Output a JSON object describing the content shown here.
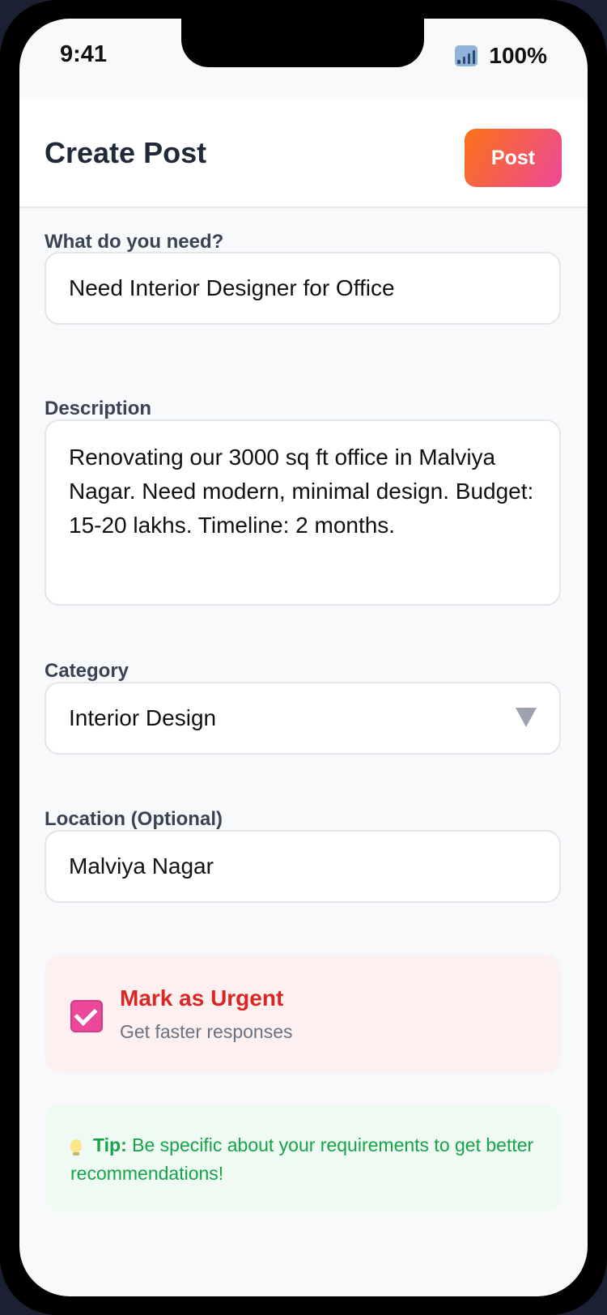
{
  "status_bar": {
    "time": "9:41",
    "battery": "100%",
    "signal_icon": "signal-icon"
  },
  "header": {
    "title": "Create Post",
    "post_label": "Post"
  },
  "form": {
    "need": {
      "label": "What do you need?",
      "value": "Need Interior Designer for Office"
    },
    "description": {
      "label": "Description",
      "value": "Renovating our 3000 sq ft office in Malviya Nagar. Need modern, minimal design. Budget: 15-20 lakhs. Timeline: 2 months."
    },
    "category": {
      "label": "Category",
      "value": "Interior Design"
    },
    "location": {
      "label": "Location (Optional)",
      "value": "Malviya Nagar"
    }
  },
  "urgent": {
    "checked": true,
    "title": "Mark as Urgent",
    "subtitle": "Get faster responses"
  },
  "tip": {
    "icon": "lightbulb-icon",
    "label": "Tip:",
    "text": "Be specific about your requirements to get better recommendations!"
  },
  "colors": {
    "accent_start": "#f97316",
    "accent_end": "#ec4899",
    "urgent": "#dc2626",
    "tip": "#16a34a"
  }
}
